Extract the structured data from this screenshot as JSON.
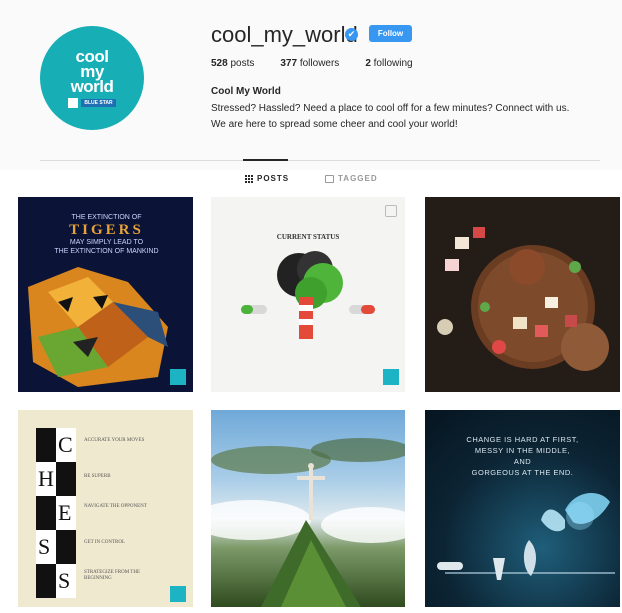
{
  "profile": {
    "avatar_text": [
      "cool",
      "my",
      "world"
    ],
    "avatar_badge": "BLUE STAR",
    "username": "cool_my_world",
    "verified_glyph": "✔",
    "follow_label": "Follow",
    "stats": {
      "posts_count": "528",
      "posts_label": "posts",
      "followers_count": "377",
      "followers_label": "followers",
      "following_count": "2",
      "following_label": "following"
    },
    "bio_name": "Cool My World",
    "bio_lines": [
      "Stressed? Hassled? Need a place to cool off for a few minutes? Connect with us.",
      "We are here to spread some cheer and cool your world!"
    ]
  },
  "tabs": [
    {
      "label": "POSTS",
      "active": true
    },
    {
      "label": "TAGGED",
      "active": false
    }
  ],
  "posts": {
    "tiger": {
      "line1": "THE EXTINCTION OF",
      "big": "TIGERS",
      "line2": "MAY SIMPLY LEAD TO",
      "line3": "THE EXTINCTION OF MANKIND"
    },
    "tree": {
      "title": "CURRENT STATUS"
    },
    "chess": {
      "letters": [
        "C",
        "H",
        "E",
        "S",
        "S"
      ],
      "lines": [
        "ACCURATE YOUR MOVES",
        "BE SUPERB",
        "NAVIGATE THE OPPONENT",
        "GET IN CONTROL",
        "STRATEGIZE FROM THE BEGINNING"
      ]
    },
    "quote": {
      "l1": "CHANGE IS HARD AT FIRST,",
      "l2": "MESSY IN THE MIDDLE,",
      "l3": "AND",
      "l4": "GORGEOUS AT THE END."
    }
  },
  "colors": {
    "accent": "#3897f0",
    "avatar_bg": "#17aeb6"
  }
}
